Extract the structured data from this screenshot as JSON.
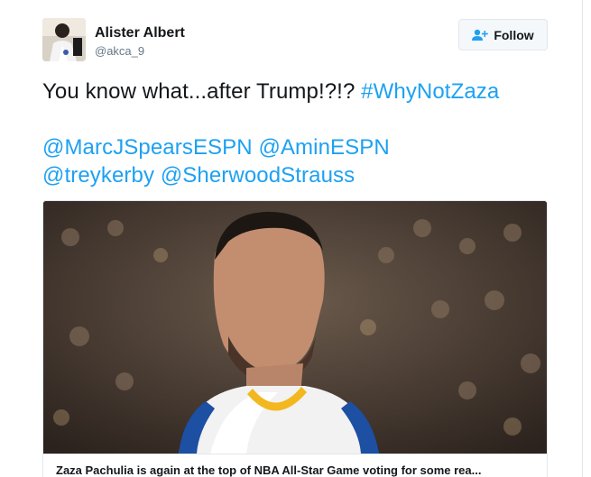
{
  "author": {
    "full_name": "Alister Albert",
    "username": "@akca_9",
    "avatar_icon": "profile-photo"
  },
  "follow_button": {
    "label": "Follow",
    "icon": "add-user-icon"
  },
  "tweet": {
    "text_plain": "You know what...after Trump!?!? ",
    "hashtag": "#WhyNotZaza",
    "mentions": [
      "@MarcJSpearsESPN",
      "@AminESPN",
      "@treykerby",
      "@SherwoodStrauss"
    ]
  },
  "card": {
    "image": "basketball-player-photo",
    "caption": "Zaza Pachulia is again at the top of NBA All-Star Game voting for some rea..."
  },
  "colors": {
    "link": "#1da1f2",
    "text": "#14171a",
    "muted": "#657786",
    "border": "#e1e8ed"
  }
}
